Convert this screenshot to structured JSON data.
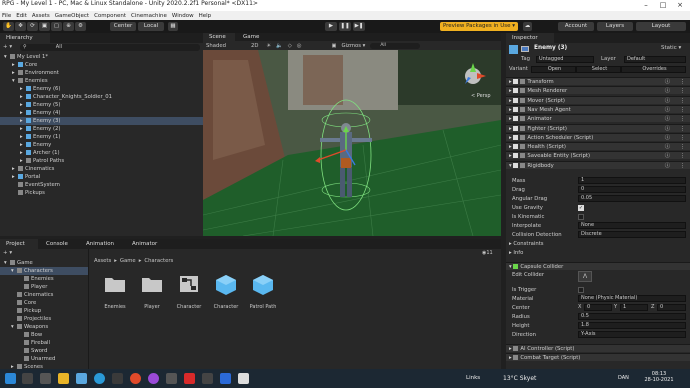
{
  "titlebar": {
    "title": "RPG - My Level 1 - PC, Mac & Linux Standalone - Unity 2020.2.2f1 Personal* <DX11>"
  },
  "menu": [
    "File",
    "Edit",
    "Assets",
    "GameObject",
    "Component",
    "Cinemachine",
    "Window",
    "Help"
  ],
  "toolbar": {
    "pivot": "Center",
    "space": "Local",
    "preview_packages": "Preview Packages in Use ▾",
    "account": "Account",
    "layers": "Layers",
    "layout": "Layout"
  },
  "hierarchy": {
    "tab": "Hierarchy",
    "add": "+ ▾",
    "search_placeholder": "All",
    "items": [
      {
        "label": "My Level 1*",
        "indent": 0,
        "arrow": "▾",
        "cube": "grey"
      },
      {
        "label": "Core",
        "indent": 1,
        "arrow": "▸",
        "cube": "blue"
      },
      {
        "label": "Environment",
        "indent": 1,
        "arrow": "▸",
        "cube": "grey"
      },
      {
        "label": "Enemies",
        "indent": 1,
        "arrow": "▾",
        "cube": "grey"
      },
      {
        "label": "Enemy (6)",
        "indent": 2,
        "arrow": "▸",
        "cube": "blue"
      },
      {
        "label": "Character_Knights_Soldier_01",
        "indent": 2,
        "arrow": "▸",
        "cube": "blue"
      },
      {
        "label": "Enemy (5)",
        "indent": 2,
        "arrow": "▸",
        "cube": "blue"
      },
      {
        "label": "Enemy (4)",
        "indent": 2,
        "arrow": "▸",
        "cube": "blue"
      },
      {
        "label": "Enemy (3)",
        "indent": 2,
        "arrow": "▸",
        "cube": "blue",
        "selected": true
      },
      {
        "label": "Enemy (2)",
        "indent": 2,
        "arrow": "▸",
        "cube": "blue"
      },
      {
        "label": "Enemy (1)",
        "indent": 2,
        "arrow": "▸",
        "cube": "blue"
      },
      {
        "label": "Enemy",
        "indent": 2,
        "arrow": "▸",
        "cube": "blue"
      },
      {
        "label": "Archer (1)",
        "indent": 2,
        "arrow": "▸",
        "cube": "blue"
      },
      {
        "label": "Patrol Paths",
        "indent": 2,
        "arrow": "▸",
        "cube": "grey"
      },
      {
        "label": "Cinematics",
        "indent": 1,
        "arrow": "▸",
        "cube": "grey"
      },
      {
        "label": "Portal",
        "indent": 1,
        "arrow": "▸",
        "cube": "blue"
      },
      {
        "label": "EventSystem",
        "indent": 1,
        "arrow": "",
        "cube": "grey"
      },
      {
        "label": "Pickups",
        "indent": 1,
        "arrow": "",
        "cube": "grey"
      }
    ]
  },
  "scene": {
    "tabs": [
      "Scene",
      "Game"
    ],
    "shading": "Shaded",
    "mode": "2D",
    "gizmos": "Gizmos ▾",
    "search_placeholder": "All",
    "persp": "< Persp"
  },
  "project": {
    "tabs": [
      "Project",
      "Console",
      "Animation",
      "Animator"
    ],
    "add": "+ ▾",
    "tree": [
      {
        "label": "Game",
        "indent": 0,
        "arrow": "▾"
      },
      {
        "label": "Characters",
        "indent": 1,
        "arrow": "▾",
        "selected": true
      },
      {
        "label": "Enemies",
        "indent": 2,
        "arrow": ""
      },
      {
        "label": "Player",
        "indent": 2,
        "arrow": ""
      },
      {
        "label": "Cinematics",
        "indent": 1,
        "arrow": ""
      },
      {
        "label": "Core",
        "indent": 1,
        "arrow": ""
      },
      {
        "label": "Pickup",
        "indent": 1,
        "arrow": ""
      },
      {
        "label": "Projectiles",
        "indent": 1,
        "arrow": ""
      },
      {
        "label": "Weapons",
        "indent": 1,
        "arrow": "▾"
      },
      {
        "label": "Bow",
        "indent": 2,
        "arrow": ""
      },
      {
        "label": "Fireball",
        "indent": 2,
        "arrow": ""
      },
      {
        "label": "Sword",
        "indent": 2,
        "arrow": ""
      },
      {
        "label": "Unarmed",
        "indent": 2,
        "arrow": ""
      },
      {
        "label": "Scenes",
        "indent": 1,
        "arrow": "▸"
      }
    ],
    "breadcrumb": [
      "Assets",
      "Game",
      "Characters"
    ],
    "item_count": "11",
    "assets": [
      {
        "label": "Enemies",
        "kind": "folder"
      },
      {
        "label": "Player",
        "kind": "folder"
      },
      {
        "label": "Character",
        "kind": "controller"
      },
      {
        "label": "Character",
        "kind": "prefab"
      },
      {
        "label": "Patrol Path",
        "kind": "prefab"
      }
    ]
  },
  "inspector": {
    "tab": "Inspector",
    "object_name": "Enemy (3)",
    "static_label": "Static ▾",
    "tag_label": "Tag",
    "tag_value": "Untagged",
    "layer_label": "Layer",
    "layer_value": "Default",
    "variant_label": "Variant",
    "open_btn": "Open",
    "select_btn": "Select",
    "overrides_btn": "Overrides",
    "components": [
      "Transform",
      "Mesh Renderer",
      "Mover (Script)",
      "Nav Mesh Agent",
      "Animator",
      "Fighter (Script)",
      "Action Scheduler (Script)",
      "Health (Script)",
      "Saveable Entity (Script)",
      "Rigidbody"
    ],
    "rigidbody": {
      "mass_label": "Mass",
      "mass": "1",
      "drag_label": "Drag",
      "drag": "0",
      "angular_drag_label": "Angular Drag",
      "angular_drag": "0.05",
      "use_gravity_label": "Use Gravity",
      "is_kinematic_label": "Is Kinematic",
      "interpolate_label": "Interpolate",
      "interpolate": "None",
      "collision_label": "Collision Detection",
      "collision": "Discrete",
      "constraints_label": "Constraints",
      "info_label": "Info"
    },
    "capsule": {
      "header": "Capsule Collider",
      "edit_collider_label": "Edit Collider",
      "is_trigger_label": "Is Trigger",
      "material_label": "Material",
      "material": "None (Physic Material)",
      "center_label": "Center",
      "center_x_label": "X",
      "center_x": "0",
      "center_y_label": "Y",
      "center_y": "1",
      "center_z_label": "Z",
      "center_z": "0",
      "radius_label": "Radius",
      "radius": "0.5",
      "height_label": "Height",
      "height": "1.8",
      "direction_label": "Direction",
      "direction": "Y-Axis"
    },
    "more_components": [
      "AI Controller (Script)",
      "Combat Target (Script)"
    ]
  },
  "taskbar": {
    "links": "Links",
    "weather": "13°C Skyet",
    "lang": "DAN",
    "time": "08:13",
    "date": "28-10-2021"
  },
  "colors": {
    "accent_blue": "#3e4d62",
    "preview_yellow": "#f0b020",
    "cube_blue": "#5aa8e0"
  }
}
